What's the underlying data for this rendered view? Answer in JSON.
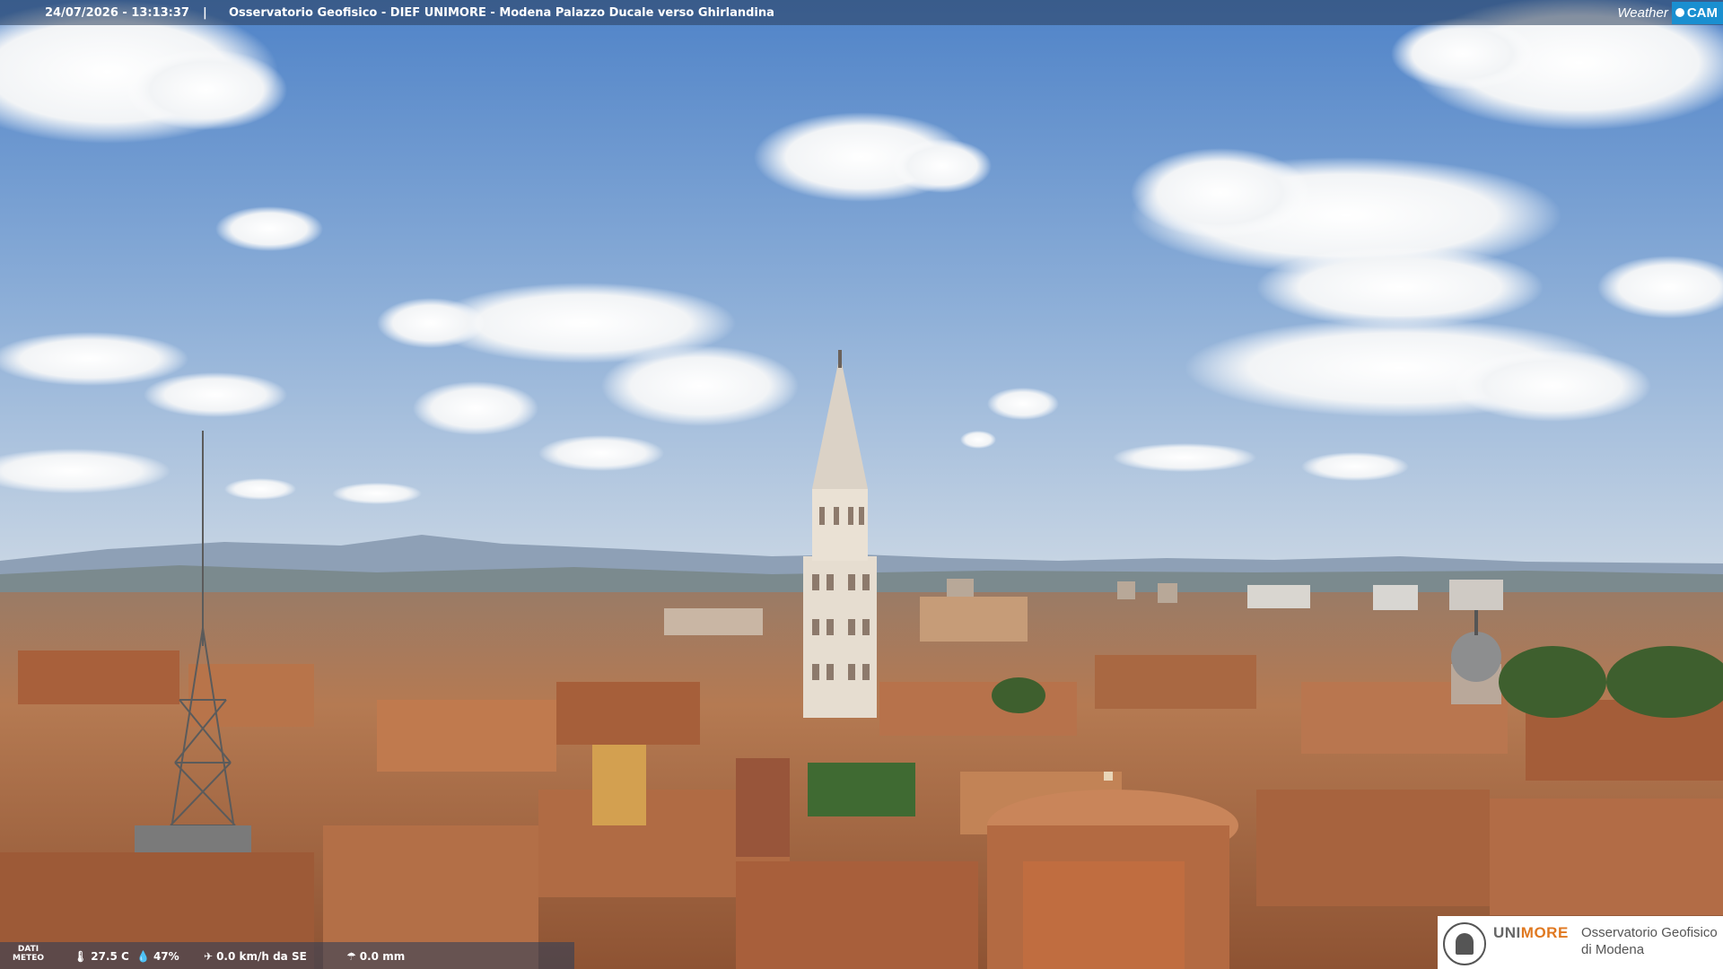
{
  "header": {
    "timestamp": "24/07/2026 - 13:13:37",
    "separator": "|",
    "title": "Osservatorio Geofisico - DIEF UNIMORE - Modena Palazzo Ducale verso Ghirlandina"
  },
  "brand": {
    "weather": "Weather",
    "cam": "CAM"
  },
  "meteo": {
    "label_line1": "DATI",
    "label_line2": "METEO",
    "temperature": "27.5 C",
    "humidity": "47%",
    "wind": "0.0 km/h da SE",
    "rain": "0.0 mm"
  },
  "logo": {
    "uni_part1": "UNI",
    "uni_part2": "MORE",
    "line1": "Osservatorio Geofisico",
    "line2": "di Modena"
  },
  "colors": {
    "sky_top": "#5f8fcf",
    "sky_horizon": "#b9cbe0",
    "roof": "#b06a42",
    "tower": "#e8ddd0",
    "accent": "#1a8fd0",
    "orange": "#e07820"
  },
  "icons": [
    "thermometer-icon",
    "humidity-drop-icon",
    "wind-icon",
    "rain-icon",
    "seal-icon"
  ]
}
